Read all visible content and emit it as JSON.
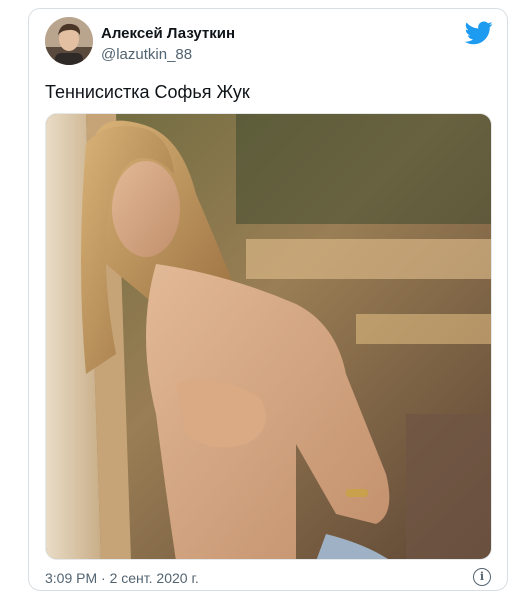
{
  "tweet": {
    "author": {
      "name": "Алексей Лазуткин",
      "handle": "@lazutkin_88"
    },
    "text": "Теннисистка Софья Жук",
    "timestamp": "3:09 PM · 2 сент. 2020 г.",
    "media": {
      "icon": "photo"
    }
  },
  "icons": {
    "brand": "twitter-bird-icon",
    "info": "info-icon",
    "info_glyph": "i"
  },
  "colors": {
    "brand": "#1d9bf0",
    "text": "#0f1419",
    "secondary": "#536471",
    "border": "#d9dee3"
  }
}
